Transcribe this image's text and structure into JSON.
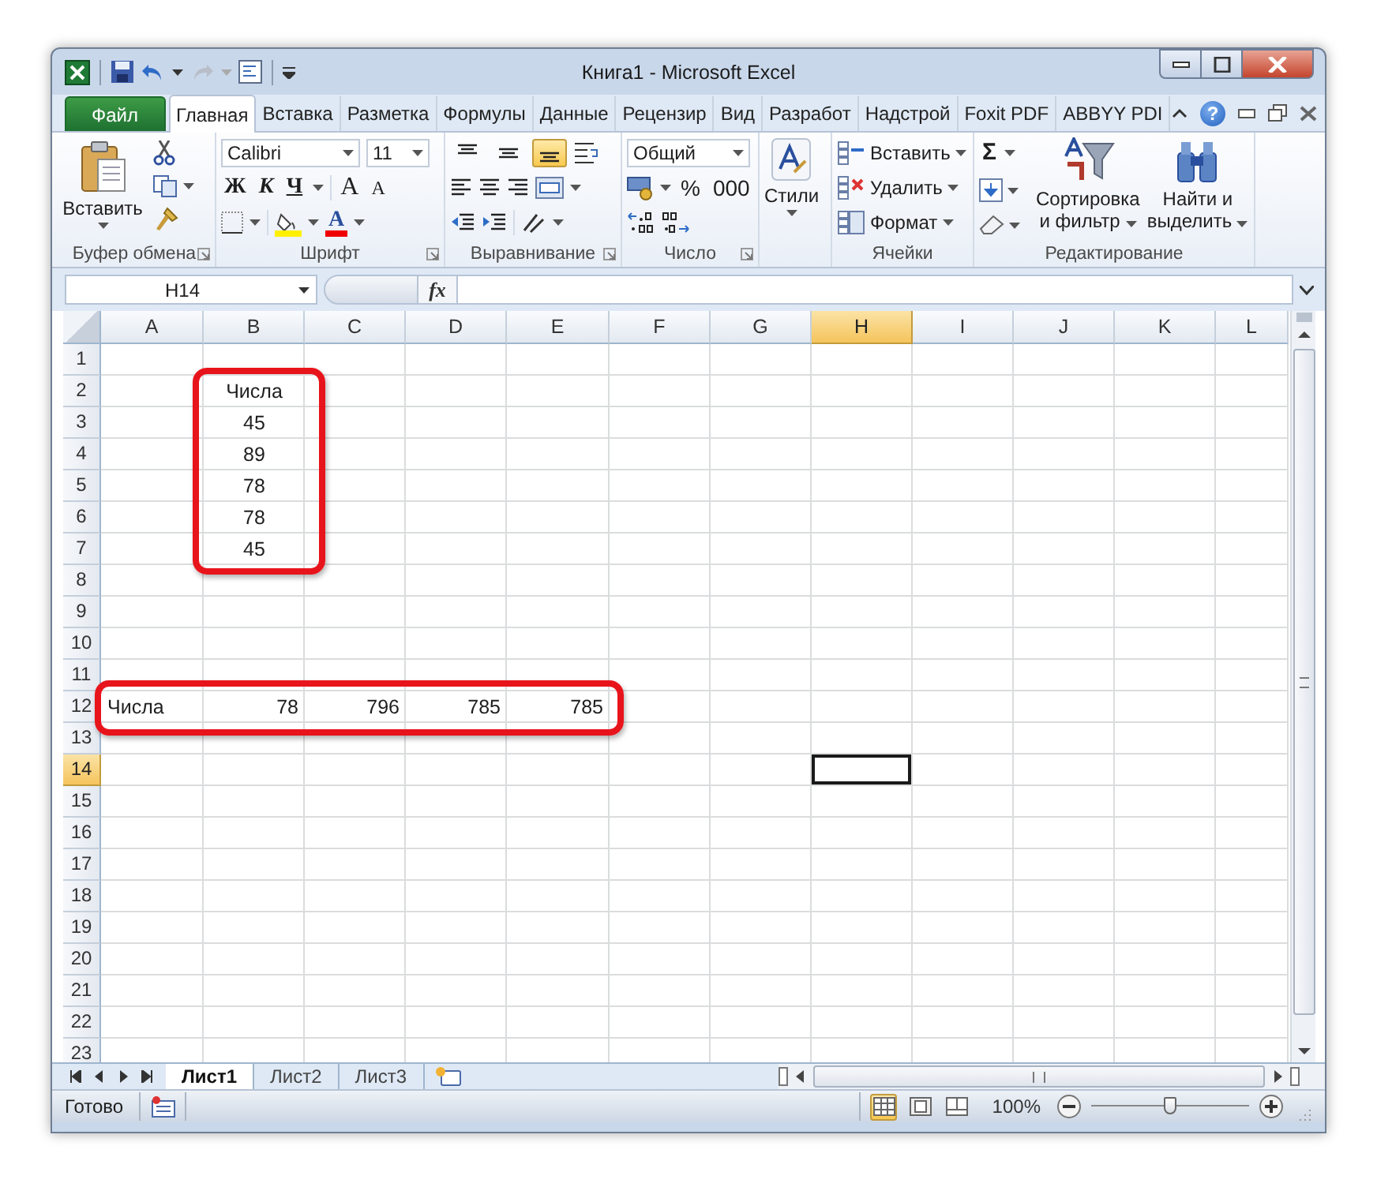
{
  "window": {
    "title": "Книга1 - Microsoft Excel"
  },
  "ribbon": {
    "tabs": [
      {
        "label": "Файл",
        "kind": "file",
        "selected": false
      },
      {
        "label": "Главная",
        "kind": "tab",
        "selected": true
      },
      {
        "label": "Вставка",
        "kind": "tab",
        "selected": false
      },
      {
        "label": "Разметка",
        "kind": "tab",
        "selected": false
      },
      {
        "label": "Формулы",
        "kind": "tab",
        "selected": false
      },
      {
        "label": "Данные",
        "kind": "tab",
        "selected": false
      },
      {
        "label": "Рецензир",
        "kind": "tab",
        "selected": false
      },
      {
        "label": "Вид",
        "kind": "tab",
        "selected": false
      },
      {
        "label": "Разработ",
        "kind": "tab",
        "selected": false
      },
      {
        "label": "Надстрой",
        "kind": "tab",
        "selected": false
      },
      {
        "label": "Foxit PDF",
        "kind": "tab",
        "selected": false
      },
      {
        "label": "ABBYY PDI",
        "kind": "tab",
        "selected": false
      }
    ],
    "help": "?",
    "clipboard": {
      "label": "Буфер обмена",
      "paste": "Вставить"
    },
    "font": {
      "label": "Шрифт",
      "family": "Calibri",
      "size": "11",
      "bold": "Ж",
      "italic": "К",
      "underline": "Ч",
      "grow": "A",
      "shrink": "A",
      "color_letter": "A"
    },
    "alignment": {
      "label": "Выравнивание",
      "vertical": [
        {
          "selected": false
        },
        {
          "selected": false
        },
        {
          "selected": true
        }
      ]
    },
    "number": {
      "label": "Число",
      "format": "Общий",
      "percent": "%",
      "thousands": "000"
    },
    "styles": {
      "label": "Стили"
    },
    "cells": {
      "label": "Ячейки",
      "commands": [
        "Вставить",
        "Удалить",
        "Формат"
      ]
    },
    "editing": {
      "label": "Редактирование",
      "sum": "Σ",
      "sort": "Сортировка и фильтр",
      "find": "Найти и выделить"
    }
  },
  "formula_bar": {
    "name_box": "H14",
    "fx": "fx"
  },
  "sheet": {
    "columns": [
      {
        "label": "A",
        "selected": false
      },
      {
        "label": "B",
        "selected": false
      },
      {
        "label": "C",
        "selected": false
      },
      {
        "label": "D",
        "selected": false
      },
      {
        "label": "E",
        "selected": false
      },
      {
        "label": "F",
        "selected": false
      },
      {
        "label": "G",
        "selected": false
      },
      {
        "label": "H",
        "selected": true
      },
      {
        "label": "I",
        "selected": false
      },
      {
        "label": "J",
        "selected": false
      },
      {
        "label": "K",
        "selected": false
      },
      {
        "label": "L",
        "selected": false
      }
    ],
    "rows": [
      {
        "label": "1",
        "selected": false
      },
      {
        "label": "2",
        "selected": false,
        "cells": [
          {},
          {
            "text": "Числа",
            "kind": "centered"
          }
        ]
      },
      {
        "label": "3",
        "selected": false,
        "cells": [
          {},
          {
            "text": "45",
            "kind": "centered"
          }
        ]
      },
      {
        "label": "4",
        "selected": false,
        "cells": [
          {},
          {
            "text": "89",
            "kind": "centered"
          }
        ]
      },
      {
        "label": "5",
        "selected": false,
        "cells": [
          {},
          {
            "text": "78",
            "kind": "centered"
          }
        ]
      },
      {
        "label": "6",
        "selected": false,
        "cells": [
          {},
          {
            "text": "78",
            "kind": "centered"
          }
        ]
      },
      {
        "label": "7",
        "selected": false,
        "cells": [
          {},
          {
            "text": "45",
            "kind": "centered"
          }
        ]
      },
      {
        "label": "8",
        "selected": false
      },
      {
        "label": "9",
        "selected": false
      },
      {
        "label": "10",
        "selected": false
      },
      {
        "label": "11",
        "selected": false
      },
      {
        "label": "12",
        "selected": false,
        "cells": [
          {
            "text": "Числа",
            "kind": "text"
          },
          {
            "text": "78",
            "kind": "number"
          },
          {
            "text": "796",
            "kind": "number"
          },
          {
            "text": "785",
            "kind": "number"
          },
          {
            "text": "785",
            "kind": "number"
          }
        ]
      },
      {
        "label": "13",
        "selected": false
      },
      {
        "label": "14",
        "selected": true
      },
      {
        "label": "15",
        "selected": false
      },
      {
        "label": "16",
        "selected": false
      },
      {
        "label": "17",
        "selected": false
      },
      {
        "label": "18",
        "selected": false
      },
      {
        "label": "19",
        "selected": false
      },
      {
        "label": "20",
        "selected": false
      },
      {
        "label": "21",
        "selected": false
      },
      {
        "label": "22",
        "selected": false
      },
      {
        "label": "23",
        "selected": false
      }
    ]
  },
  "sheet_tabs": [
    {
      "label": "Лист1",
      "selected": true
    },
    {
      "label": "Лист2",
      "selected": false
    },
    {
      "label": "Лист3",
      "selected": false
    }
  ],
  "status_bar": {
    "text": "Готово",
    "views": [
      {
        "kind": "normal",
        "selected": true
      },
      {
        "kind": "page_layout",
        "selected": false
      },
      {
        "kind": "page_break",
        "selected": false
      }
    ],
    "zoom": "100%",
    "zoom_slider": {
      "level": 0.5
    }
  }
}
